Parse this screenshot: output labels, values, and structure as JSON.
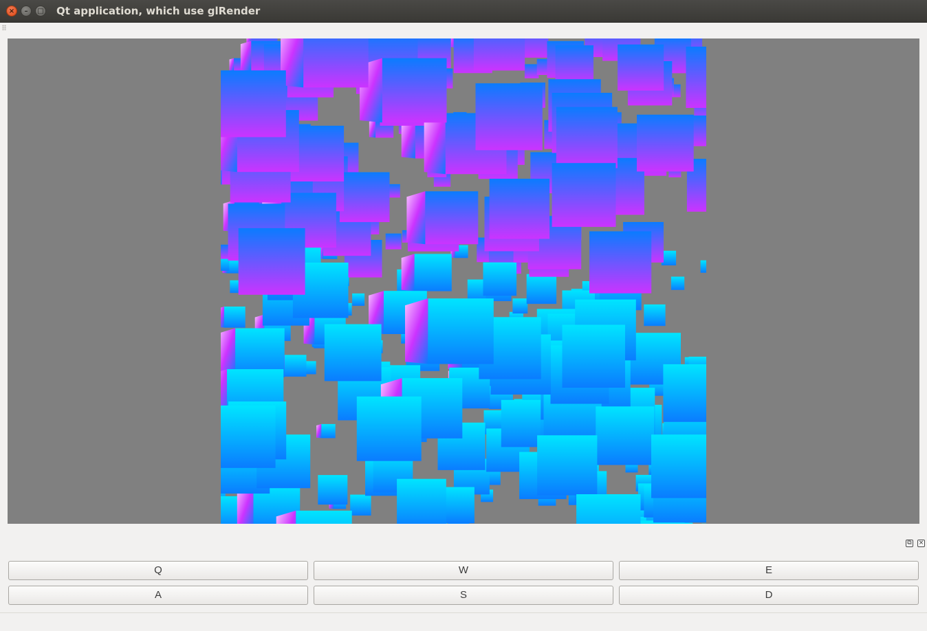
{
  "window": {
    "title": "Qt application, which use glRender",
    "close_icon": "close-icon",
    "minimize_icon": "minimize-icon",
    "maximize_icon": "maximize-icon"
  },
  "dock": {
    "float_icon": "dock-float-icon",
    "close_icon": "dock-close-icon"
  },
  "controls": {
    "row1": [
      "Q",
      "W",
      "E"
    ],
    "row2": [
      "A",
      "S",
      "D"
    ]
  },
  "scene": {
    "background_color": "#808080",
    "cube_top_color": "#00e5ff",
    "cube_mid_color": "#0a7cff",
    "cube_bottom_color": "#cc33ff",
    "texture_accent": "#f7c6ff"
  }
}
